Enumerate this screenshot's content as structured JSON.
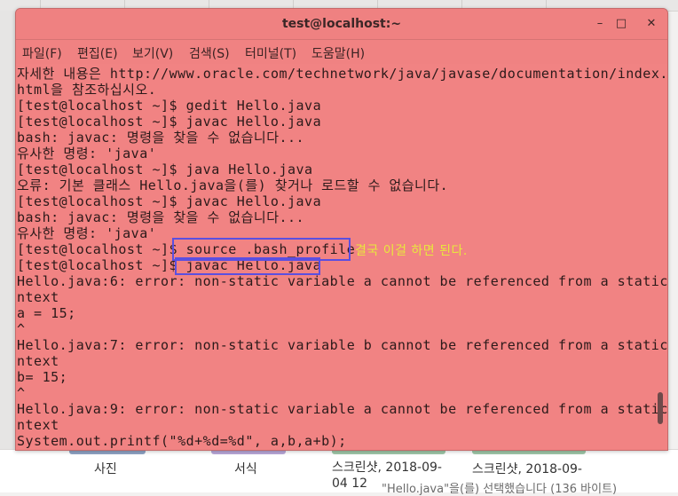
{
  "background_window": {
    "items": [
      {
        "label": "사진"
      },
      {
        "label": "서식"
      },
      {
        "label": "스크린샷, 2018-09-04 12"
      },
      {
        "label": "스크린샷, 2018-09-"
      }
    ],
    "status_text": "\"Hello.java\"을(를) 선택했습니다 (136 바이트)"
  },
  "terminal": {
    "title": "test@localhost:~",
    "window_buttons": {
      "minimize": "–",
      "maximize": "□",
      "close": "✕"
    },
    "menu": [
      "파일(F)",
      "편집(E)",
      "보기(V)",
      "검색(S)",
      "터미널(T)",
      "도움말(H)"
    ],
    "lines": [
      "자세한 내용은 http://www.oracle.com/technetwork/java/javase/documentation/index.",
      "html을 참조하십시오.",
      "[test@localhost ~]$ gedit Hello.java",
      "[test@localhost ~]$ javac Hello.java",
      "bash: javac: 명령을 찾을 수 없습니다...",
      "유사한 명령: 'java'",
      "[test@localhost ~]$ java Hello.java",
      "오류: 기본 클래스 Hello.java을(를) 찾거나 로드할 수 없습니다.",
      "[test@localhost ~]$ javac Hello.java",
      "bash: javac: 명령을 찾을 수 없습니다...",
      "유사한 명령: 'java'",
      "[test@localhost ~]$ source .bash_profile",
      "[test@localhost ~]$ javac Hello.java",
      "Hello.java:6: error: non-static variable a cannot be referenced from a static co",
      "ntext",
      "a = 15;",
      "^",
      "Hello.java:7: error: non-static variable b cannot be referenced from a static co",
      "ntext",
      "b= 15;",
      "^",
      "Hello.java:9: error: non-static variable a cannot be referenced from a static co",
      "ntext",
      "System.out.printf(\"%d+%d=%d\", a,b,a+b);"
    ],
    "annotation": "결국 이걸 하면 된다."
  },
  "colors": {
    "terminal_bg": "#f18383",
    "highlight_box": "#5b4fe0",
    "annotation_text": "#e8e83c"
  }
}
